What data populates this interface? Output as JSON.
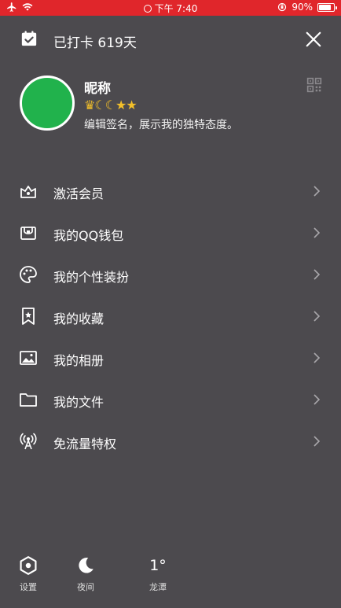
{
  "status_bar": {
    "time": "下午 7:40",
    "battery": "90%",
    "battery_level": 0.9
  },
  "header": {
    "checkin_text": "已打卡 619天"
  },
  "profile": {
    "nickname": "昵称",
    "badges": [
      "crown",
      "moon",
      "moon",
      "star",
      "star"
    ],
    "signature": "编辑签名，展示我的独特态度。",
    "avatar_color": "#21b24c"
  },
  "menu": {
    "items": [
      {
        "label": "激活会员",
        "icon": "vip-crown-icon"
      },
      {
        "label": "我的QQ钱包",
        "icon": "wallet-icon"
      },
      {
        "label": "我的个性装扮",
        "icon": "palette-icon"
      },
      {
        "label": "我的收藏",
        "icon": "bookmark-star-icon"
      },
      {
        "label": "我的相册",
        "icon": "photo-album-icon"
      },
      {
        "label": "我的文件",
        "icon": "folder-icon"
      },
      {
        "label": "免流量特权",
        "icon": "signal-tower-icon"
      }
    ]
  },
  "bottom_bar": {
    "settings_label": "设置",
    "night_label": "夜间",
    "weather_temp": "1°",
    "weather_city": "龙潭"
  },
  "colors": {
    "background": "#4c4a4e",
    "status_bar": "#e0262b",
    "text": "#ffffff"
  }
}
